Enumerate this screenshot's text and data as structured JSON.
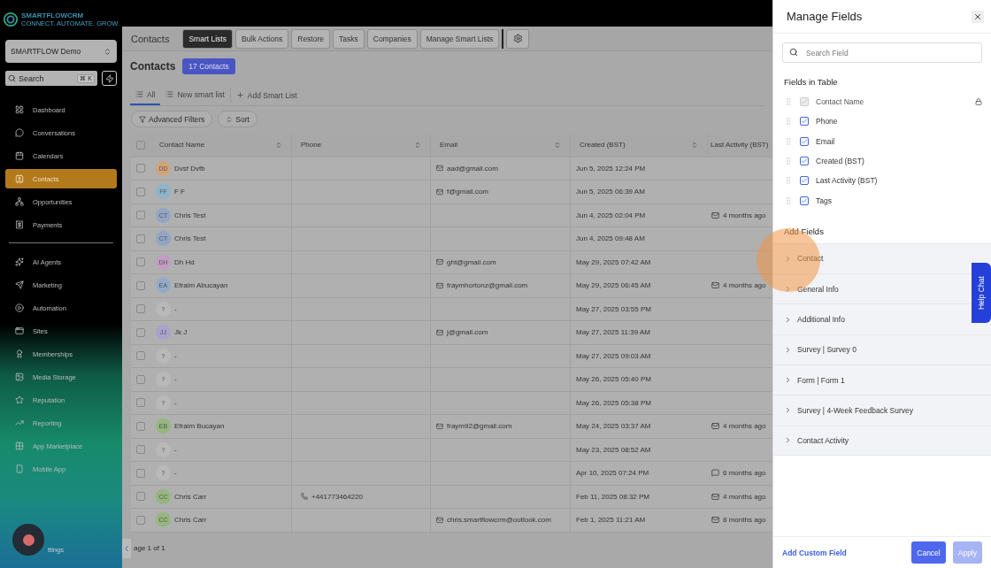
{
  "sidebar": {
    "logo": {
      "name": "SMARTFLOWCRM",
      "tagline": "CONNECT. AUTOMATE. GROW."
    },
    "account": "SMARTFLOW Demo",
    "search": {
      "placeholder": "Search",
      "shortcut": "⌘ K"
    },
    "nav_groups": [
      [
        {
          "label": "Dashboard",
          "selected": false
        },
        {
          "label": "Conversations",
          "selected": false
        },
        {
          "label": "Calendars",
          "selected": false
        },
        {
          "label": "Contacts",
          "selected": true
        },
        {
          "label": "Opportunities",
          "selected": false
        },
        {
          "label": "Payments",
          "selected": false
        }
      ],
      [
        {
          "label": "AI Agents",
          "selected": false
        },
        {
          "label": "Marketing",
          "selected": false
        },
        {
          "label": "Automation",
          "selected": false
        },
        {
          "label": "Sites",
          "selected": false
        },
        {
          "label": "Memberships",
          "selected": false
        },
        {
          "label": "Media Storage",
          "selected": false
        },
        {
          "label": "Reputation",
          "selected": false
        },
        {
          "label": "Reporting",
          "selected": false
        },
        {
          "label": "App Marketplace",
          "selected": false
        },
        {
          "label": "Mobile App",
          "selected": false
        }
      ]
    ],
    "settings": "ttings"
  },
  "topbar": {
    "title": "Contacts",
    "tabs": [
      {
        "label": "Smart Lists",
        "selected": true
      },
      {
        "label": "Bulk Actions",
        "selected": false
      },
      {
        "label": "Restore",
        "selected": false
      },
      {
        "label": "Tasks",
        "selected": false
      },
      {
        "label": "Companies",
        "selected": false
      },
      {
        "label": "Manage Smart Lists",
        "selected": false
      }
    ]
  },
  "heading": {
    "title": "Contacts",
    "count": "17 Contacts"
  },
  "list_tabs": [
    {
      "label": "All",
      "selected": true
    },
    {
      "label": "New smart list",
      "selected": false
    }
  ],
  "add_list": "Add Smart List",
  "filters": [
    "Advanced Filters",
    "Sort"
  ],
  "table": {
    "select_all_checked": false,
    "columns": [
      "Contact Name",
      "Phone",
      "Email",
      "Created (BST)",
      "Last Activity (BST)"
    ],
    "rows": [
      {
        "checked": false,
        "initials": "DD",
        "color": "#d2a47c",
        "name": "Dvsf Dvfb",
        "email": "aad@gmail.com",
        "created": "Jun 5, 2025  12:24 PM"
      },
      {
        "checked": false,
        "initials": "FF",
        "color": "#8eb4cc",
        "name": "F F",
        "email": "f@gmail.com",
        "created": "Jun 5, 2025  06:39 AM"
      },
      {
        "checked": false,
        "initials": "CT",
        "color": "#93a5c4",
        "name": "Chris Test",
        "created": "Jun 4, 2025  02:04 PM",
        "activity": {
          "kind": "mail",
          "text": "4 months ago"
        }
      },
      {
        "checked": false,
        "initials": "CT",
        "color": "#93a5c4",
        "name": "Chris Test",
        "created": "Jun 4, 2025  09:48 AM"
      },
      {
        "checked": false,
        "initials": "DH",
        "color": "#c29cc2",
        "name": "Dh Hd",
        "email": "ght@gmail.com",
        "created": "May 29, 2025  07:42 AM"
      },
      {
        "checked": false,
        "initials": "EA",
        "color": "#91aac8",
        "name": "Efraim Abucayan",
        "email": "fraymhortonz@gmail.com",
        "created": "May 29, 2025  06:45 AM",
        "activity": {
          "kind": "mail",
          "text": "4 months ago"
        }
      },
      {
        "checked": false,
        "initials": "?",
        "color": "#b9b9b9",
        "name": "-",
        "created": "May 27, 2025  03:55 PM"
      },
      {
        "checked": false,
        "initials": "JJ",
        "color": "#a9a2cc",
        "name": "Jk J",
        "email": "j@gmail.com",
        "created": "May 27, 2025  11:39 AM"
      },
      {
        "checked": false,
        "initials": "?",
        "color": "#b9b9b9",
        "name": "-",
        "created": "May 27, 2025  09:03 AM"
      },
      {
        "checked": false,
        "initials": "?",
        "color": "#b9b9b9",
        "name": "-",
        "created": "May 26, 2025  05:40 PM"
      },
      {
        "checked": false,
        "initials": "?",
        "color": "#b9b9b9",
        "name": "-",
        "created": "May 26, 2025  05:38 PM"
      },
      {
        "checked": false,
        "initials": "EB",
        "color": "#95b67f",
        "name": "Efraim Bucayan",
        "email": "fraym92@gmail.com",
        "created": "May 24, 2025  03:37 AM",
        "activity": {
          "kind": "mail",
          "text": "4 months ago"
        }
      },
      {
        "checked": false,
        "initials": "?",
        "color": "#b9b9b9",
        "name": "-",
        "created": "May 23, 2025  08:52 AM"
      },
      {
        "checked": false,
        "initials": "?",
        "color": "#b9b9b9",
        "name": "-",
        "created": "Apr 10, 2025  07:24 PM",
        "activity": {
          "kind": "chat",
          "text": "6 months ago"
        }
      },
      {
        "checked": false,
        "initials": "CC",
        "color": "#95b67f",
        "name": "Chris Carr",
        "phone": "+441773464220",
        "created": "Feb 11, 2025  08:32 PM",
        "activity": {
          "kind": "mail",
          "text": "4 months ago"
        }
      },
      {
        "checked": false,
        "initials": "CC",
        "color": "#95b67f",
        "name": "Chris Carr",
        "email": "chris.smartflowcrm@outlook.com",
        "created": "Feb 1, 2025  11:21 AM",
        "activity": {
          "kind": "mail",
          "text": "8 months ago"
        }
      }
    ]
  },
  "pagination": "age 1 of 1",
  "drawer": {
    "title": "Manage Fields",
    "search_placeholder": "Search Field",
    "fields_title": "Fields in Table",
    "fields": [
      {
        "label": "Contact Name",
        "checked": true,
        "disabled": true,
        "locked": true
      },
      {
        "label": "Phone",
        "checked": true,
        "disabled": false,
        "locked": false
      },
      {
        "label": "Email",
        "checked": true,
        "disabled": false,
        "locked": false
      },
      {
        "label": "Created (BST)",
        "checked": true,
        "disabled": false,
        "locked": false
      },
      {
        "label": "Last Activity (BST)",
        "checked": true,
        "disabled": false,
        "locked": false
      },
      {
        "label": "Tags",
        "checked": true,
        "disabled": false,
        "locked": false
      }
    ],
    "add_title": "Add Fields",
    "sections": [
      {
        "label": "Contact",
        "expanded": false
      },
      {
        "label": "General Info",
        "expanded": false
      },
      {
        "label": "Additional Info",
        "expanded": false
      },
      {
        "label": "Survey | Survey 0",
        "expanded": false
      },
      {
        "label": "Form | Form 1",
        "expanded": false
      },
      {
        "label": "Survey | 4-Week Feedback Survey",
        "expanded": false
      },
      {
        "label": "Contact Activity",
        "expanded": false
      }
    ],
    "add_custom": "Add Custom Field",
    "cancel": "Cancel",
    "apply": "Apply"
  },
  "help_chat": "Help Chat"
}
